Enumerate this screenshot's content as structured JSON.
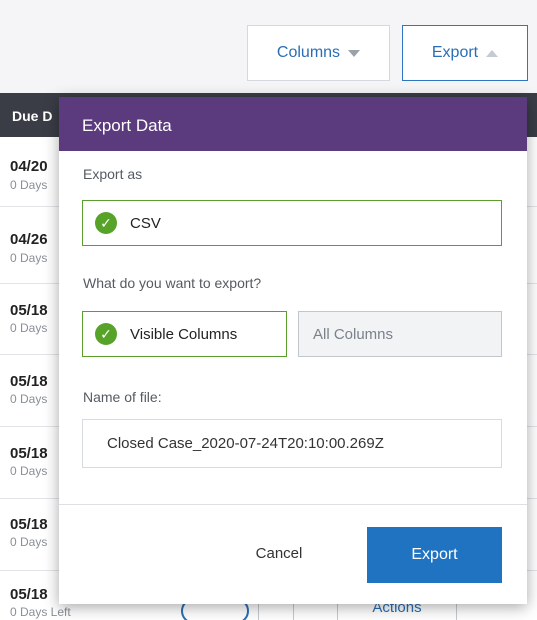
{
  "toolbar": {
    "columns_label": "Columns",
    "export_label": "Export"
  },
  "table": {
    "header_partial": "Due D",
    "rows": [
      {
        "date": "04/20",
        "left": "0 Days"
      },
      {
        "date": "04/26",
        "left": "0 Days"
      },
      {
        "date": "05/18",
        "left": "0 Days"
      },
      {
        "date": "05/18",
        "left": "0 Days"
      },
      {
        "date": "05/18",
        "left": "0 Days"
      },
      {
        "date": "05/18",
        "left": "0 Days"
      },
      {
        "date": "05/18",
        "left": "0 Days Left"
      }
    ],
    "row_actions_label": "Actions"
  },
  "modal": {
    "title": "Export Data",
    "export_as_label": "Export as",
    "format_option": "CSV",
    "what_label": "What do you want to export?",
    "visible_columns": "Visible Columns",
    "all_columns": "All Columns",
    "filename_label": "Name of file:",
    "filename_value": "Closed Case_2020-07-24T20:10:00.269Z",
    "cancel_label": "Cancel",
    "export_label": "Export"
  },
  "icons": {
    "check": "check-icon",
    "caret_down": "caret-down-icon",
    "caret_up": "caret-up-icon"
  },
  "colors": {
    "header_purple": "#5b3a7e",
    "primary_blue": "#1f73c1",
    "success_green": "#57a228"
  }
}
